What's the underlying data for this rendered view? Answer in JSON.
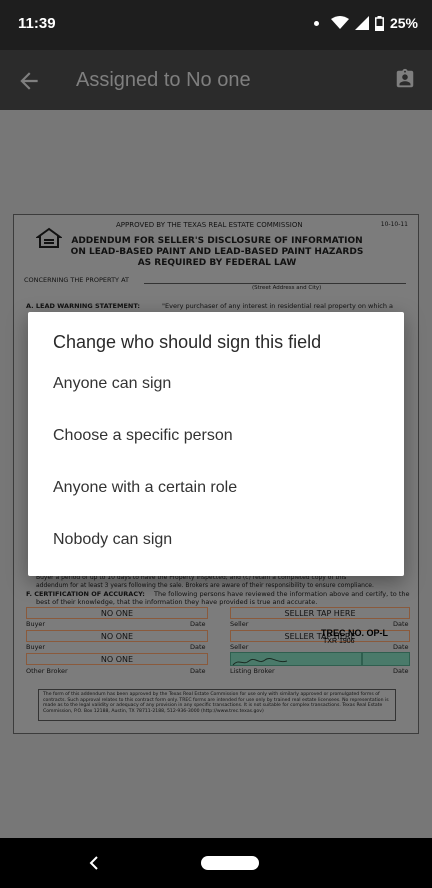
{
  "status": {
    "time": "11:39",
    "battery": "25%"
  },
  "appbar": {
    "title": "Assigned to No one"
  },
  "document": {
    "approved": "APPROVED BY THE TEXAS REAL ESTATE COMMISSION",
    "date": "10-10-11",
    "heading": [
      "ADDENDUM FOR SELLER'S DISCLOSURE OF INFORMATION",
      "ON LEAD-BASED PAINT AND LEAD-BASED PAINT HAZARDS",
      "AS REQUIRED BY FEDERAL LAW"
    ],
    "concerning": "CONCERNING THE PROPERTY AT",
    "street_caption": "(Street Address and City)",
    "lead_warning": "A. LEAD WARNING STATEMENT:",
    "lead_warning_text": "\"Every purchaser of any interest in residential real property on which a",
    "cut_line1": "Buyer a period of up to 10 days to have the Property inspected; and (c) retain a completed copy of this",
    "cut_line2": "addendum for at least 3 years following the sale. Brokers are aware of their responsibility to ensure compliance.",
    "certification_title": "F. CERTIFICATION OF ACCURACY:",
    "certification_text": "The following persons have reviewed the information above and certify, to the",
    "certification_text2": "best of their knowledge, that the information they have provided is true and accurate.",
    "fields": {
      "no_one": "NO ONE",
      "seller_tap": "SELLER TAP HERE"
    },
    "labels": {
      "buyer": "Buyer",
      "date": "Date",
      "seller": "Seller",
      "other_broker": "Other Broker",
      "listing_broker": "Listing Broker"
    },
    "notice": "The form of this addendum has been approved by the Texas Real Estate Commission for use only with similarly approved or promulgated forms of contracts. Such approval relates to this contract form only. TREC forms are intended for use only by trained real estate licensees. No representation is made as to the legal validity or adequacy of any provision in any specific transactions. It is not suitable for complex transactions. Texas Real Estate Commission, P.O. Box 12188, Austin, TX 78711-2188, 512-936-3000 (http://www.trec.texas.gov)",
    "trec": "TREC NO. OP-L",
    "txr": "TXR 1906"
  },
  "dialog": {
    "title": "Change who should sign this field",
    "options": [
      "Anyone can sign",
      "Choose a specific person",
      "Anyone with a certain role",
      "Nobody can sign"
    ]
  },
  "icons": {
    "back": "arrow-left-icon",
    "contact": "contact-card-icon",
    "wifi": "wifi-icon",
    "signal": "signal-icon",
    "battery": "battery-icon",
    "equal_housing": "equal-housing-icon"
  }
}
